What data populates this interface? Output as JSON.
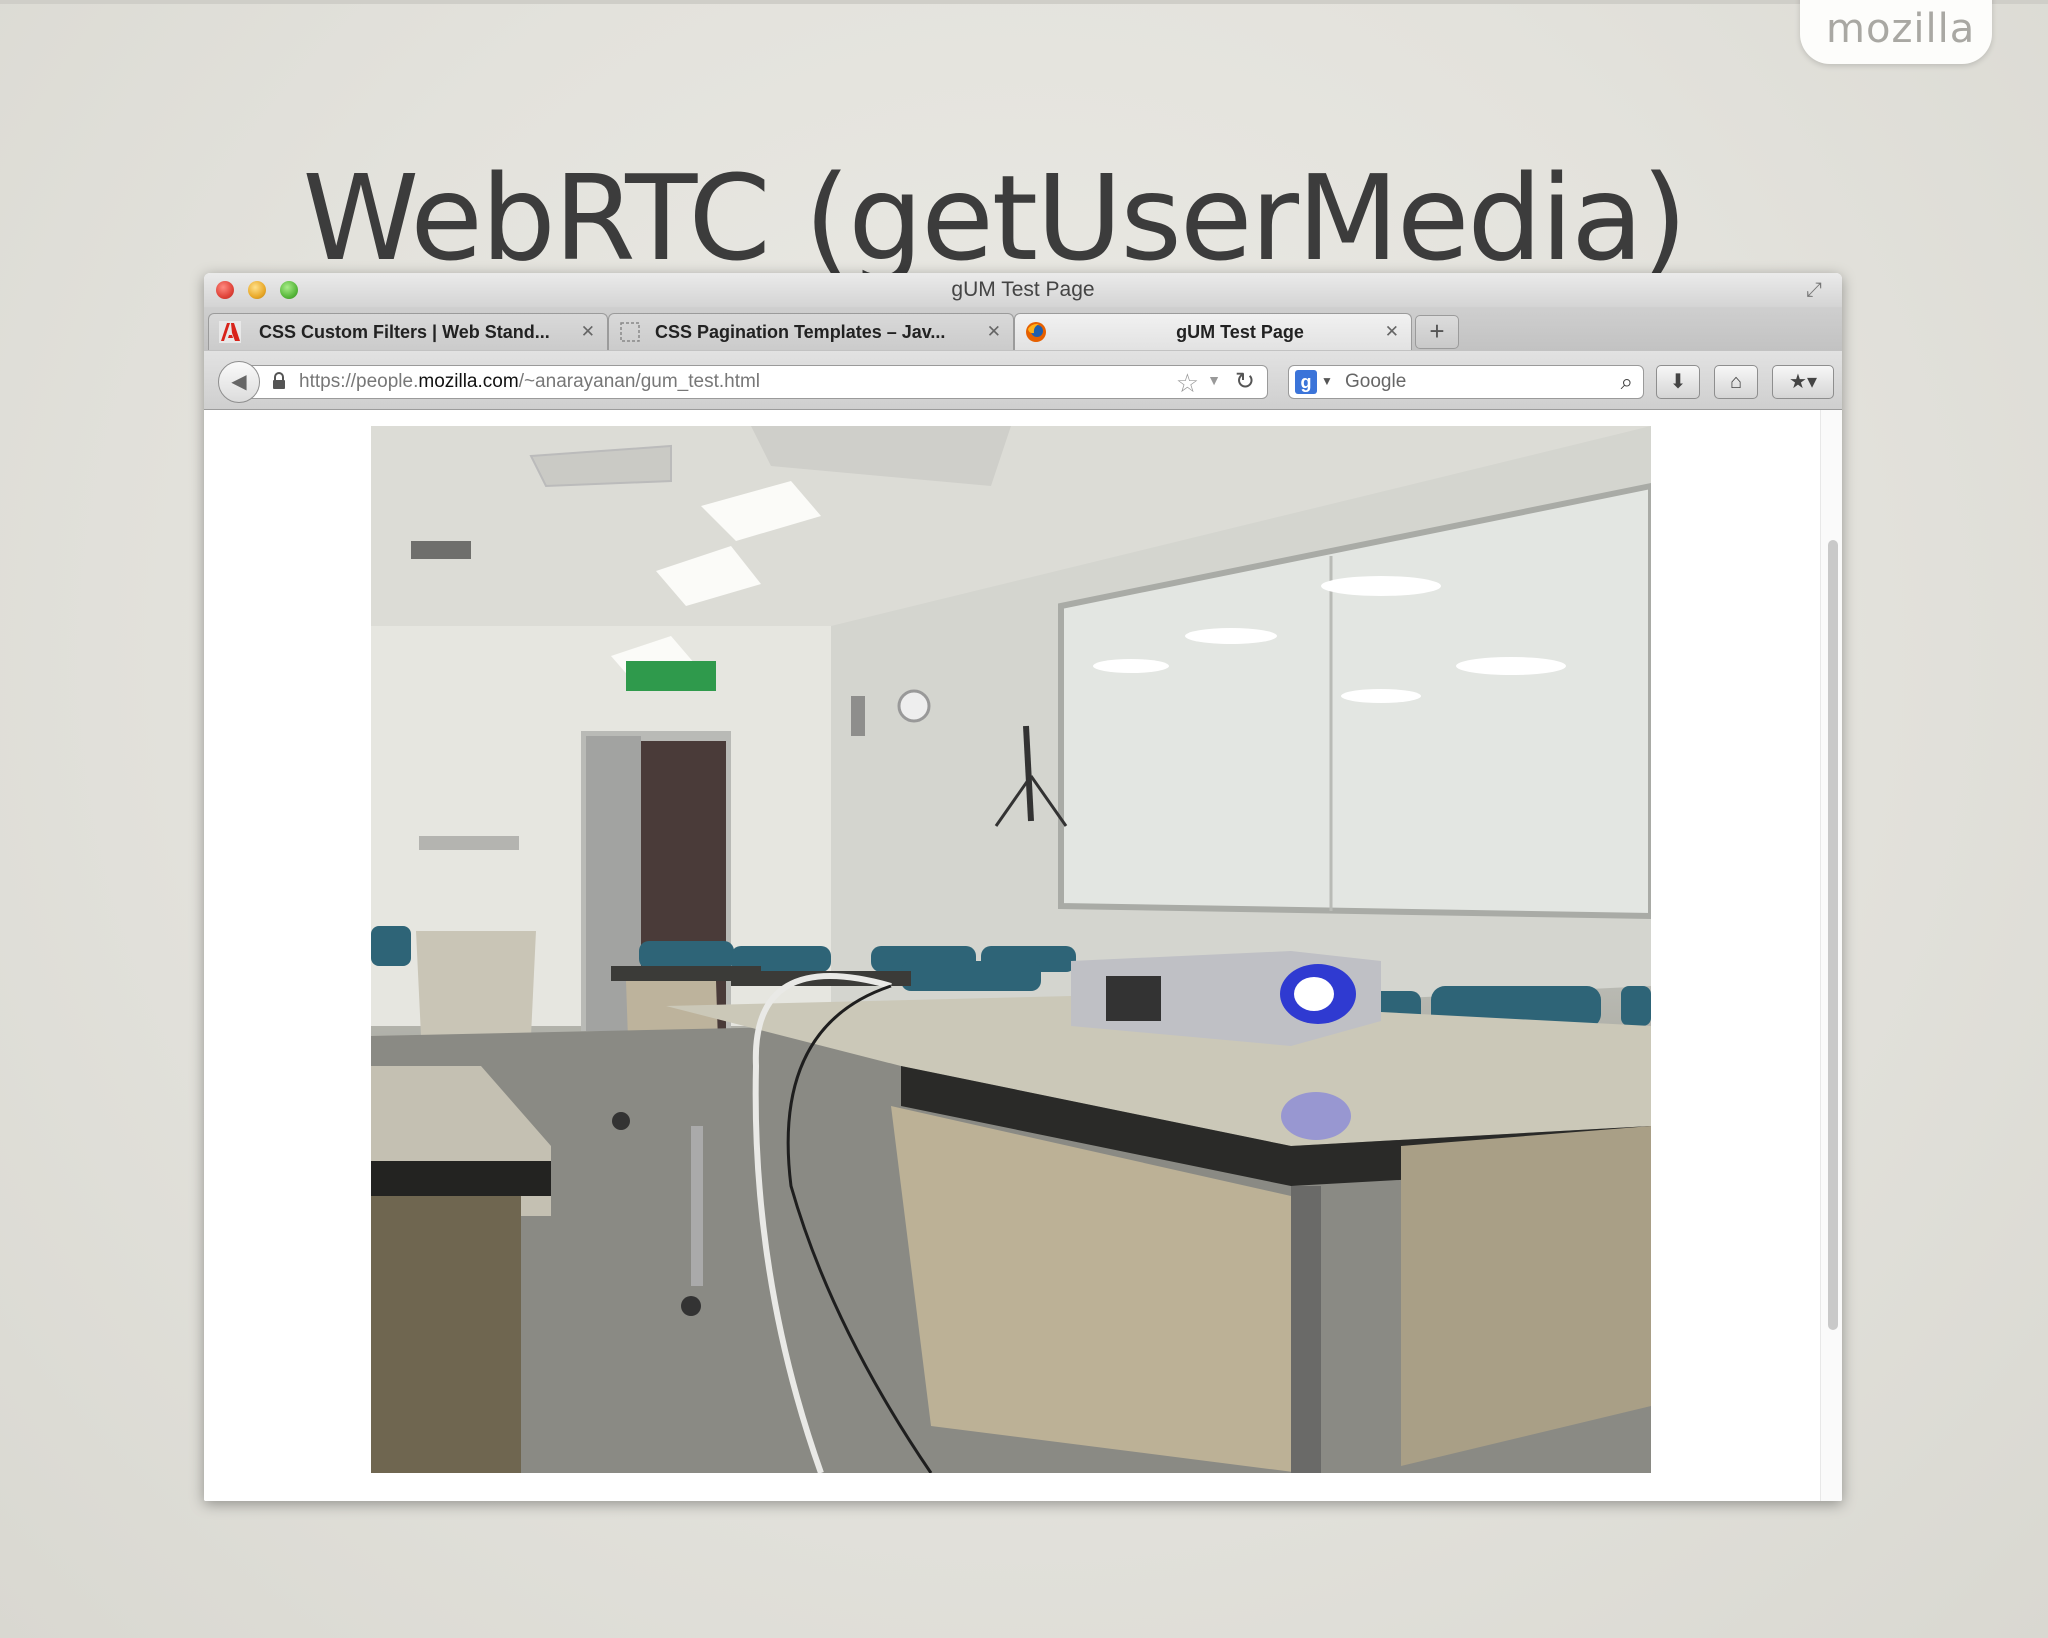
{
  "slide": {
    "title": "WebRTC (getUserMedia)",
    "brand": "mozilla"
  },
  "window": {
    "title": "gUM Test Page"
  },
  "tabs": [
    {
      "label": "CSS Custom Filters | Web Stand...",
      "favicon": "adobe-icon",
      "active": false
    },
    {
      "label": "CSS Pagination Templates – Jav...",
      "favicon": "blank-page-icon",
      "active": false
    },
    {
      "label": "gUM Test Page",
      "favicon": "firefox-icon",
      "active": true
    }
  ],
  "navbar": {
    "url_prefix": "https://people.",
    "url_domain": "mozilla.com",
    "url_path": "/~anarayanan/gum_test.html",
    "search_placeholder": "Google"
  },
  "colors": {
    "title_text": "#3c3c3c",
    "brand_text": "#a9a8a3",
    "projector_light": "#3a3cff"
  }
}
